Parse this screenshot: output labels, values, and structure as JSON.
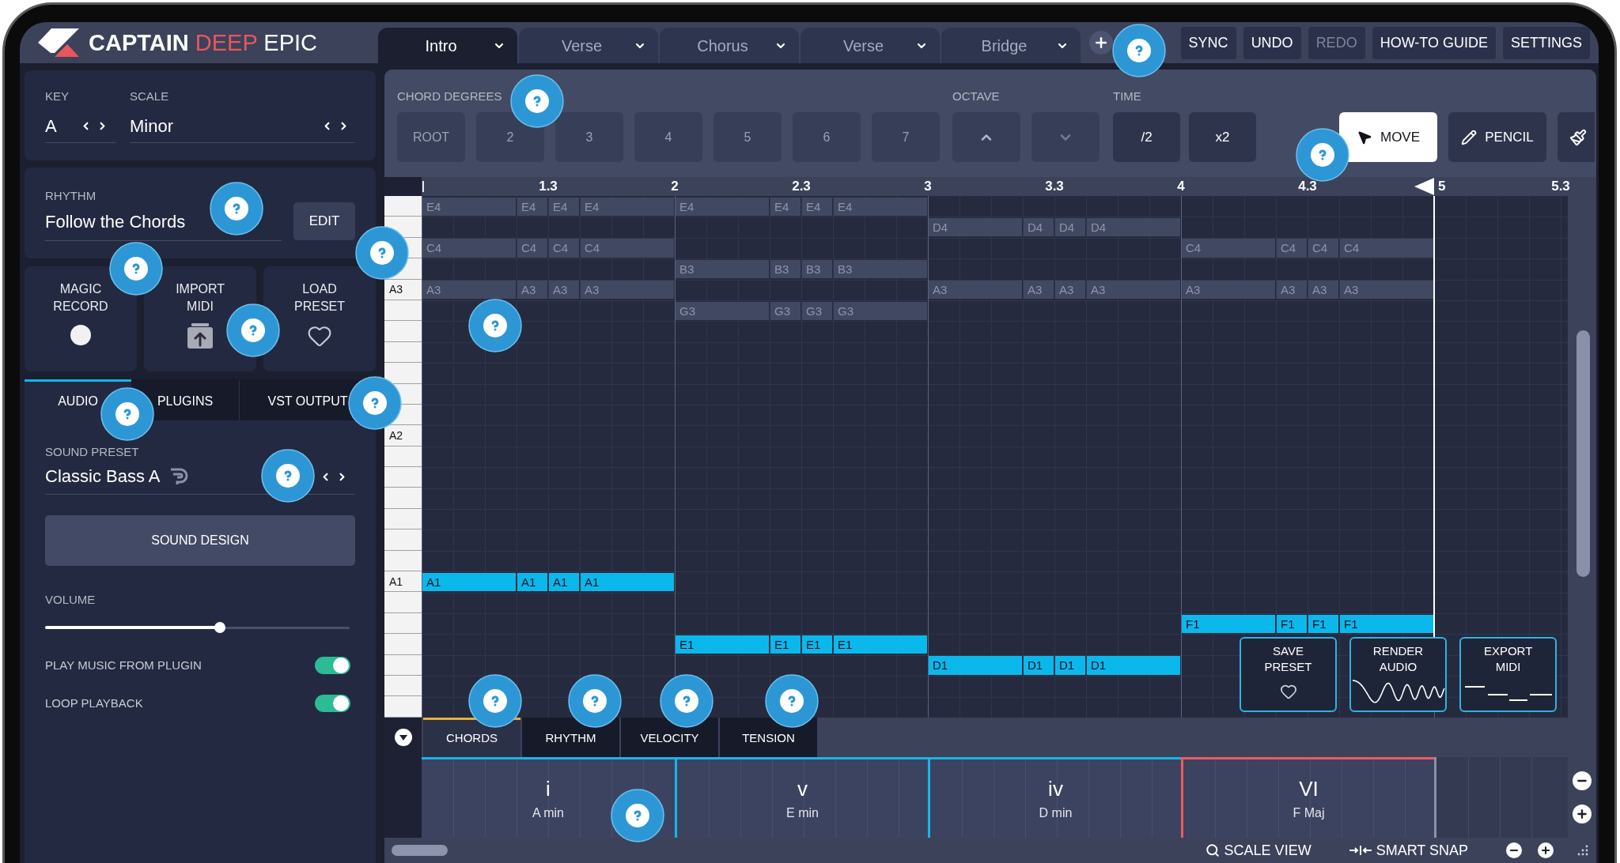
{
  "app_title": {
    "words": [
      {
        "text": "CAPTAIN",
        "kind": "bold"
      },
      {
        "text": "DEEP",
        "kind": "accent"
      },
      {
        "text": "EPIC",
        "kind": "light"
      }
    ]
  },
  "section_tabs": [
    {
      "label": "Intro",
      "selected": true
    },
    {
      "label": "Verse",
      "selected": false
    },
    {
      "label": "Chorus",
      "selected": false
    },
    {
      "label": "Verse",
      "selected": false
    },
    {
      "label": "Bridge",
      "selected": false
    }
  ],
  "header_buttons": [
    {
      "label": "SYNC",
      "disabled": false
    },
    {
      "label": "UNDO",
      "disabled": false
    },
    {
      "label": "REDO",
      "disabled": true
    },
    {
      "label": "HOW-TO GUIDE",
      "disabled": false
    },
    {
      "label": "SETTINGS",
      "disabled": false
    }
  ],
  "key": {
    "label": "KEY",
    "value": "A"
  },
  "scale": {
    "label": "SCALE",
    "value": "Minor"
  },
  "rhythm": {
    "label": "RHYTHM",
    "value": "Follow the Chords",
    "button": "EDIT"
  },
  "actions": [
    {
      "label": "MAGIC RECORD",
      "kind": "record"
    },
    {
      "label": "IMPORT MIDI",
      "kind": "import"
    },
    {
      "label": "LOAD PRESET",
      "kind": "heart"
    }
  ],
  "panel_tabs": [
    {
      "label": "AUDIO",
      "selected": true
    },
    {
      "label": "PLUGINS",
      "selected": false
    },
    {
      "label": "VST OUTPUT",
      "selected": false
    }
  ],
  "sound_preset": {
    "label": "SOUND PRESET",
    "value": "Classic Bass A"
  },
  "sound_design_button": "SOUND DESIGN",
  "volume": {
    "label": "VOLUME",
    "level": 0.575
  },
  "toggles": [
    {
      "label": "PLAY MUSIC FROM PLUGIN",
      "on": true
    },
    {
      "label": "LOOP PLAYBACK",
      "on": true
    }
  ],
  "toolbar": {
    "chord_degrees": {
      "label": "CHORD DEGREES",
      "buttons": [
        "ROOT",
        "2",
        "3",
        "4",
        "5",
        "6",
        "7"
      ]
    },
    "octave": {
      "label": "OCTAVE"
    },
    "time": {
      "label": "TIME",
      "buttons": [
        "/2",
        "x2"
      ]
    },
    "tools": [
      {
        "kind": "move",
        "label": "MOVE",
        "selected": true
      },
      {
        "kind": "pencil",
        "label": "PENCIL",
        "selected": false
      },
      {
        "kind": "brush",
        "selected": false
      }
    ]
  },
  "piano_roll": {
    "ruler": [
      "1.3",
      "2",
      "2.3",
      "3",
      "3.3",
      "4",
      "4.3",
      "5",
      "5.3"
    ],
    "rows": [
      {
        "bars": [
          {
            "kind": "chord",
            "labels": [
              "E4",
              "E4",
              "E4",
              "E4"
            ]
          },
          {
            "kind": "chord",
            "labels": [
              "E4",
              "E4",
              "E4",
              "E4"
            ]
          },
          {
            "kind": "empty"
          },
          {
            "kind": "empty"
          }
        ]
      },
      {
        "bars": [
          {
            "kind": "empty"
          },
          {
            "kind": "empty"
          },
          {
            "kind": "chord",
            "labels": [
              "D4",
              "D4",
              "D4",
              "D4"
            ]
          },
          {
            "kind": "empty"
          }
        ]
      },
      {
        "bars": [
          {
            "kind": "chord",
            "labels": [
              "C4",
              "C4",
              "C4",
              "C4"
            ]
          },
          {
            "kind": "empty"
          },
          {
            "kind": "empty"
          },
          {
            "kind": "chord",
            "labels": [
              "C4",
              "C4",
              "C4",
              "C4"
            ]
          }
        ]
      },
      {
        "bars": [
          {
            "kind": "empty"
          },
          {
            "kind": "chord",
            "labels": [
              "B3",
              "B3",
              "B3",
              "B3"
            ]
          },
          {
            "kind": "empty"
          },
          {
            "kind": "empty"
          }
        ]
      },
      {
        "key_label": "A3",
        "bars": [
          {
            "kind": "chord",
            "labels": [
              "A3",
              "A3",
              "A3",
              "A3"
            ]
          },
          {
            "kind": "empty"
          },
          {
            "kind": "chord",
            "labels": [
              "A3",
              "A3",
              "A3",
              "A3"
            ]
          },
          {
            "kind": "chord",
            "labels": [
              "A3",
              "A3",
              "A3",
              "A3"
            ]
          }
        ]
      },
      {
        "bars": [
          {
            "kind": "empty"
          },
          {
            "kind": "chord",
            "labels": [
              "G3",
              "G3",
              "G3",
              "G3"
            ]
          },
          {
            "kind": "empty"
          },
          {
            "kind": "empty"
          }
        ]
      },
      {},
      {},
      {},
      {},
      {},
      {
        "key_label": "A2"
      },
      {},
      {},
      {},
      {},
      {},
      {},
      {
        "key_label": "A1",
        "bars": [
          {
            "kind": "bass",
            "labels": [
              "A1",
              "A1",
              "A1",
              "A1"
            ]
          },
          {
            "kind": "empty"
          },
          {
            "kind": "empty"
          },
          {
            "kind": "empty"
          }
        ]
      },
      {},
      {
        "bars": [
          {
            "kind": "empty"
          },
          {
            "kind": "empty"
          },
          {
            "kind": "empty"
          },
          {
            "kind": "bass",
            "labels": [
              "F1",
              "F1",
              "F1",
              "F1"
            ]
          }
        ]
      },
      {
        "bars": [
          {
            "kind": "empty"
          },
          {
            "kind": "bass",
            "labels": [
              "E1",
              "E1",
              "E1",
              "E1"
            ]
          },
          {
            "kind": "empty"
          },
          {
            "kind": "empty"
          }
        ]
      },
      {
        "bars": [
          {
            "kind": "empty"
          },
          {
            "kind": "empty"
          },
          {
            "kind": "bass",
            "labels": [
              "D1",
              "D1",
              "D1",
              "D1"
            ]
          },
          {
            "kind": "empty"
          }
        ]
      },
      {},
      {}
    ],
    "overlay_buttons": [
      {
        "label": "SAVE PRESET",
        "kind": "heart"
      },
      {
        "label": "RENDER AUDIO",
        "kind": "wave"
      },
      {
        "label": "EXPORT MIDI",
        "kind": "midi"
      }
    ]
  },
  "lane_tabs": [
    {
      "label": "CHORDS",
      "selected": true
    },
    {
      "label": "RHYTHM",
      "selected": false
    },
    {
      "label": "VELOCITY",
      "selected": false
    },
    {
      "label": "TENSION",
      "selected": false
    }
  ],
  "chord_lane": [
    {
      "numeral": "i",
      "name": "A min",
      "color": "#17b6e8"
    },
    {
      "numeral": "v",
      "name": "E min",
      "color": "#17b6e8"
    },
    {
      "numeral": "iv",
      "name": "D min",
      "color": "#17b6e8"
    },
    {
      "numeral": "VI",
      "name": "F Maj",
      "color": "#ef5a5f"
    }
  ],
  "status_bar": {
    "scale_view": "SCALE VIEW",
    "smart_snap": "SMART SNAP"
  }
}
